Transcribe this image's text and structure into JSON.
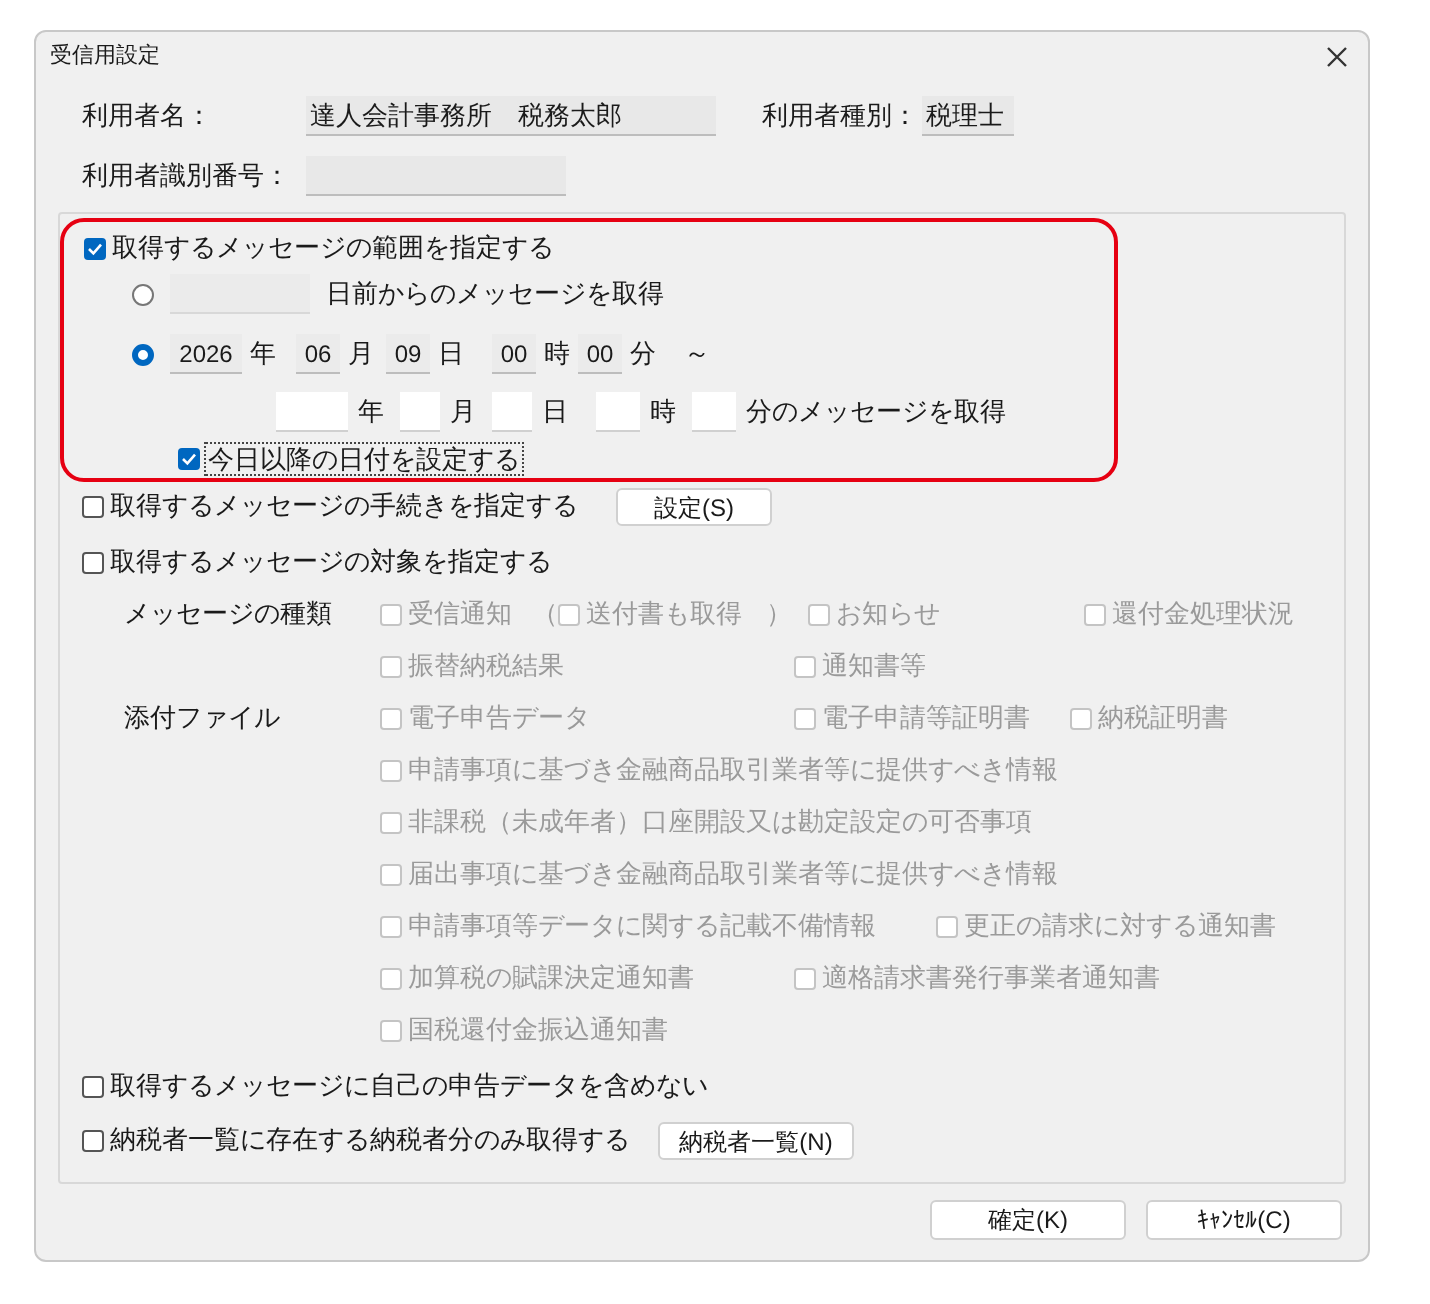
{
  "window": {
    "title": "受信用設定"
  },
  "user": {
    "name_label": "利用者名：",
    "name": "達人会計事務所　税務太郎",
    "type_label": "利用者種別：",
    "type": "税理士",
    "id_label": "利用者識別番号："
  },
  "range": {
    "label": "取得するメッセージの範囲を指定する",
    "checked": true,
    "options": [
      {
        "kind": "days",
        "selected": false,
        "suffix": "日前からのメッセージを取得"
      },
      {
        "kind": "datetime",
        "selected": true,
        "from": [
          {
            "value": "2026",
            "unit": "年"
          },
          {
            "value": "06",
            "unit": "月"
          },
          {
            "value": "09",
            "unit": "日"
          },
          {
            "value": "00",
            "unit": "時"
          },
          {
            "value": "00",
            "unit": "分"
          }
        ],
        "tilde": "～",
        "to_units": [
          "年",
          "月",
          "日",
          "時",
          "分のメッセージを取得"
        ]
      }
    ],
    "future": {
      "label": "今日以降の日付を設定する",
      "checked": true
    }
  },
  "procedure": {
    "label": "取得するメッセージの手続きを指定する",
    "checked": false,
    "button": "設定(S)"
  },
  "target": {
    "label": "取得するメッセージの対象を指定する",
    "checked": false,
    "groups": [
      {
        "label": "メッセージの種類",
        "rows": [
          [
            {
              "label": "受信通知",
              "checked": false,
              "disabled": true,
              "paren_open": "（",
              "sub": {
                "label": "送付書も取得",
                "checked": false,
                "disabled": true
              },
              "paren_close": "）"
            },
            {
              "label": "お知らせ",
              "checked": false,
              "disabled": true
            },
            {
              "label": "還付金処理状況",
              "checked": false,
              "disabled": true
            }
          ],
          [
            {
              "label": "振替納税結果",
              "checked": false,
              "disabled": true
            },
            {
              "label": "通知書等",
              "checked": false,
              "disabled": true
            }
          ]
        ]
      },
      {
        "label": "添付ファイル",
        "rows": [
          [
            {
              "label": "電子申告データ",
              "checked": false,
              "disabled": true
            },
            {
              "label": "電子申請等証明書",
              "checked": false,
              "disabled": true
            },
            {
              "label": "納税証明書",
              "checked": false,
              "disabled": true
            }
          ],
          [
            {
              "label": "申請事項に基づき金融商品取引業者等に提供すべき情報",
              "checked": false,
              "disabled": true
            }
          ],
          [
            {
              "label": "非課税（未成年者）口座開設又は勘定設定の可否事項",
              "checked": false,
              "disabled": true
            }
          ],
          [
            {
              "label": "届出事項に基づき金融商品取引業者等に提供すべき情報",
              "checked": false,
              "disabled": true
            }
          ],
          [
            {
              "label": "申請事項等データに関する記載不備情報",
              "checked": false,
              "disabled": true
            },
            {
              "label": "更正の請求に対する通知書",
              "checked": false,
              "disabled": true
            }
          ],
          [
            {
              "label": "加算税の賦課決定通知書",
              "checked": false,
              "disabled": true
            },
            {
              "label": "適格請求書発行事業者通知書",
              "checked": false,
              "disabled": true
            }
          ],
          [
            {
              "label": "国税還付金振込通知書",
              "checked": false,
              "disabled": true
            }
          ]
        ]
      }
    ]
  },
  "exclude_own": {
    "label": "取得するメッセージに自己の申告データを含めない",
    "checked": false
  },
  "taxpayer_only": {
    "label": "納税者一覧に存在する納税者分のみ取得する",
    "checked": false,
    "button": "納税者一覧(N)"
  },
  "buttons": [
    {
      "label": "確定(K)"
    },
    {
      "label": "ｷｬﾝｾﾙ(C)"
    }
  ]
}
